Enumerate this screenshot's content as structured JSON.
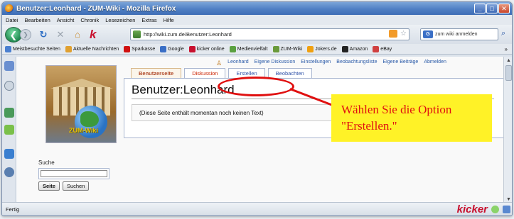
{
  "window": {
    "title": "Benutzer:Leonhard - ZUM-Wiki - Mozilla Firefox"
  },
  "menu": [
    "Datei",
    "Bearbeiten",
    "Ansicht",
    "Chronik",
    "Lesezeichen",
    "Extras",
    "Hilfe"
  ],
  "nav": {
    "url": "http://wiki.zum.de/Benutzer:Leonhard",
    "search_placeholder": "zum wiki anmelden"
  },
  "bookmarks": [
    {
      "label": "Meistbesuchte Seiten",
      "color": "#4a7fd0"
    },
    {
      "label": "Aktuelle Nachrichten",
      "color": "#e0a030"
    },
    {
      "label": "Sparkasse",
      "color": "#d01010"
    },
    {
      "label": "Google",
      "color": "#3a6fc6"
    },
    {
      "label": "kicker online",
      "color": "#c8102e"
    },
    {
      "label": "Medienvielfalt",
      "color": "#5aa040"
    },
    {
      "label": "ZUM-Wiki",
      "color": "#6a9a3a"
    },
    {
      "label": "Jokers.de",
      "color": "#f0a010"
    },
    {
      "label": "Amazon",
      "color": "#222222"
    },
    {
      "label": "eBay",
      "color": "#d04040"
    }
  ],
  "wiki": {
    "user_links": [
      "Leonhard",
      "Eigene Diskussion",
      "Einstellungen",
      "Beobachtungsliste",
      "Eigene Beiträge",
      "Abmelden"
    ],
    "tabs": [
      "Benutzerseite",
      "Diskussion",
      "Erstellen",
      "Beobachten"
    ],
    "heading": "Benutzer:Leonhard",
    "notice": "(Diese Seite enthält momentan noch keinen Text)",
    "logo_text": "ZUM-Wiki",
    "search": {
      "label": "Suche",
      "go": "Seite",
      "search": "Suchen"
    }
  },
  "annotation": {
    "line1": "Wählen Sie die Option",
    "line2": "\"Erstellen.\""
  },
  "status": {
    "text": "Fertig",
    "brand": "kicker"
  }
}
